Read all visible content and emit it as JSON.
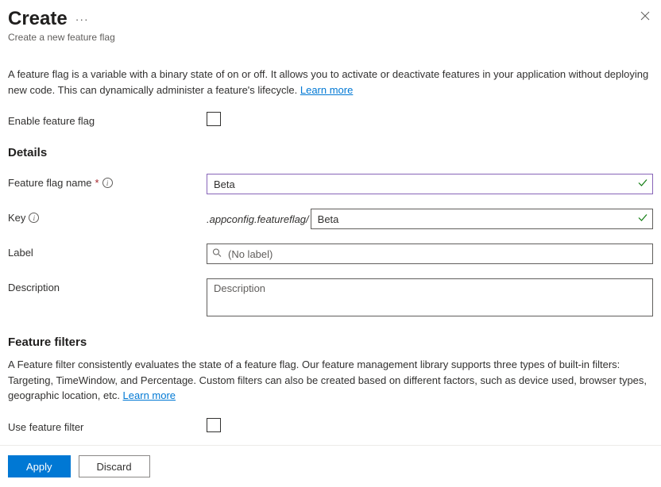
{
  "header": {
    "title": "Create",
    "subtitle": "Create a new feature flag"
  },
  "intro": {
    "text": "A feature flag is a variable with a binary state of on or off. It allows you to activate or deactivate features in your application without deploying new code. This can dynamically administer a feature's lifecycle. ",
    "learn_more": "Learn more"
  },
  "enable": {
    "label": "Enable feature flag",
    "checked": false
  },
  "details": {
    "heading": "Details",
    "name": {
      "label": "Feature flag name",
      "value": "Beta"
    },
    "key": {
      "label": "Key",
      "prefix": ".appconfig.featureflag/",
      "value": "Beta"
    },
    "label_field": {
      "label": "Label",
      "placeholder": "(No label)",
      "value": ""
    },
    "description": {
      "label": "Description",
      "placeholder": "Description",
      "value": ""
    }
  },
  "filters": {
    "heading": "Feature filters",
    "text": "A Feature filter consistently evaluates the state of a feature flag. Our feature management library supports three types of built-in filters: Targeting, TimeWindow, and Percentage. Custom filters can also be created based on different factors, such as device used, browser types, geographic location, etc. ",
    "learn_more": "Learn more",
    "use_label": "Use feature filter",
    "checked": false
  },
  "footer": {
    "apply": "Apply",
    "discard": "Discard"
  }
}
